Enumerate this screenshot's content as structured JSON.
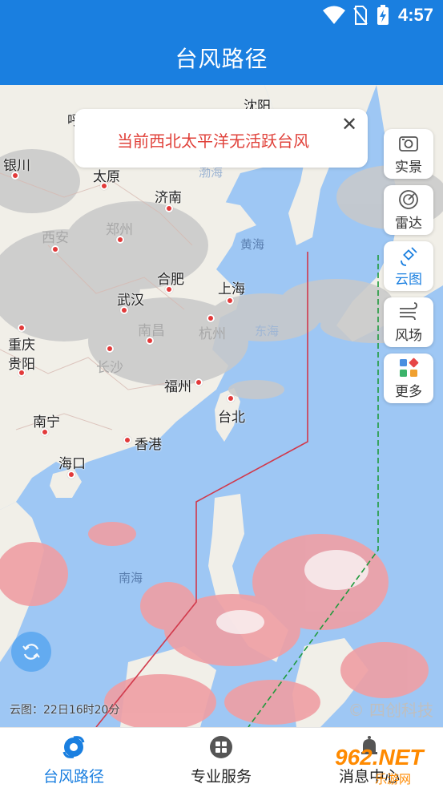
{
  "status_bar": {
    "time": "4:57"
  },
  "app_bar": {
    "title": "台风路径"
  },
  "notice": {
    "message": "当前西北太平洋无活跃台风",
    "close_glyph": "✕"
  },
  "tools": [
    {
      "label": "实景",
      "icon": "camera-icon"
    },
    {
      "label": "雷达",
      "icon": "radar-icon"
    },
    {
      "label": "云图",
      "icon": "satellite-icon",
      "active": true
    },
    {
      "label": "风场",
      "icon": "wind-icon"
    },
    {
      "label": "更多",
      "icon": "grid-more-icon"
    }
  ],
  "map": {
    "cities": {
      "hohhot": "呼和浩特",
      "shenyang": "沈阳",
      "yinchuan": "银川",
      "taiyuan": "太原",
      "jinan": "济南",
      "xian": "西安",
      "zhengzhou": "郑州",
      "hefei": "合肥",
      "shanghai": "上海",
      "wuhan": "武汉",
      "nanchang": "南昌",
      "hangzhou": "杭州",
      "chongqing": "重庆",
      "guiyang": "贵阳",
      "changsha": "长沙",
      "fuzhou": "福州",
      "taipei": "台北",
      "nanning": "南宁",
      "hongkong": "香港",
      "haikou": "海口"
    },
    "seas": {
      "bohai": "渤海",
      "yellow_sea": "黄海",
      "east_china_sea": "东海",
      "south_china_sea": "南海"
    },
    "cloud_timestamp": "云图：22日16时20分",
    "copyright": "© 四创科技"
  },
  "bottom_nav": [
    {
      "label": "台风路径",
      "active": true,
      "icon": "typhoon-icon"
    },
    {
      "label": "专业服务",
      "active": false,
      "icon": "services-icon"
    },
    {
      "label": "消息中心",
      "active": false,
      "icon": "bell-icon"
    }
  ],
  "watermark": {
    "text": "962.NET",
    "sub": "乐游网"
  },
  "colors": {
    "primary": "#1a7fe0",
    "alert": "#e0413a",
    "ocean": "#9ec7f4",
    "land": "#f1efe8",
    "warning_line": "#d1384a",
    "boundary_line": "#1f9a3c"
  }
}
